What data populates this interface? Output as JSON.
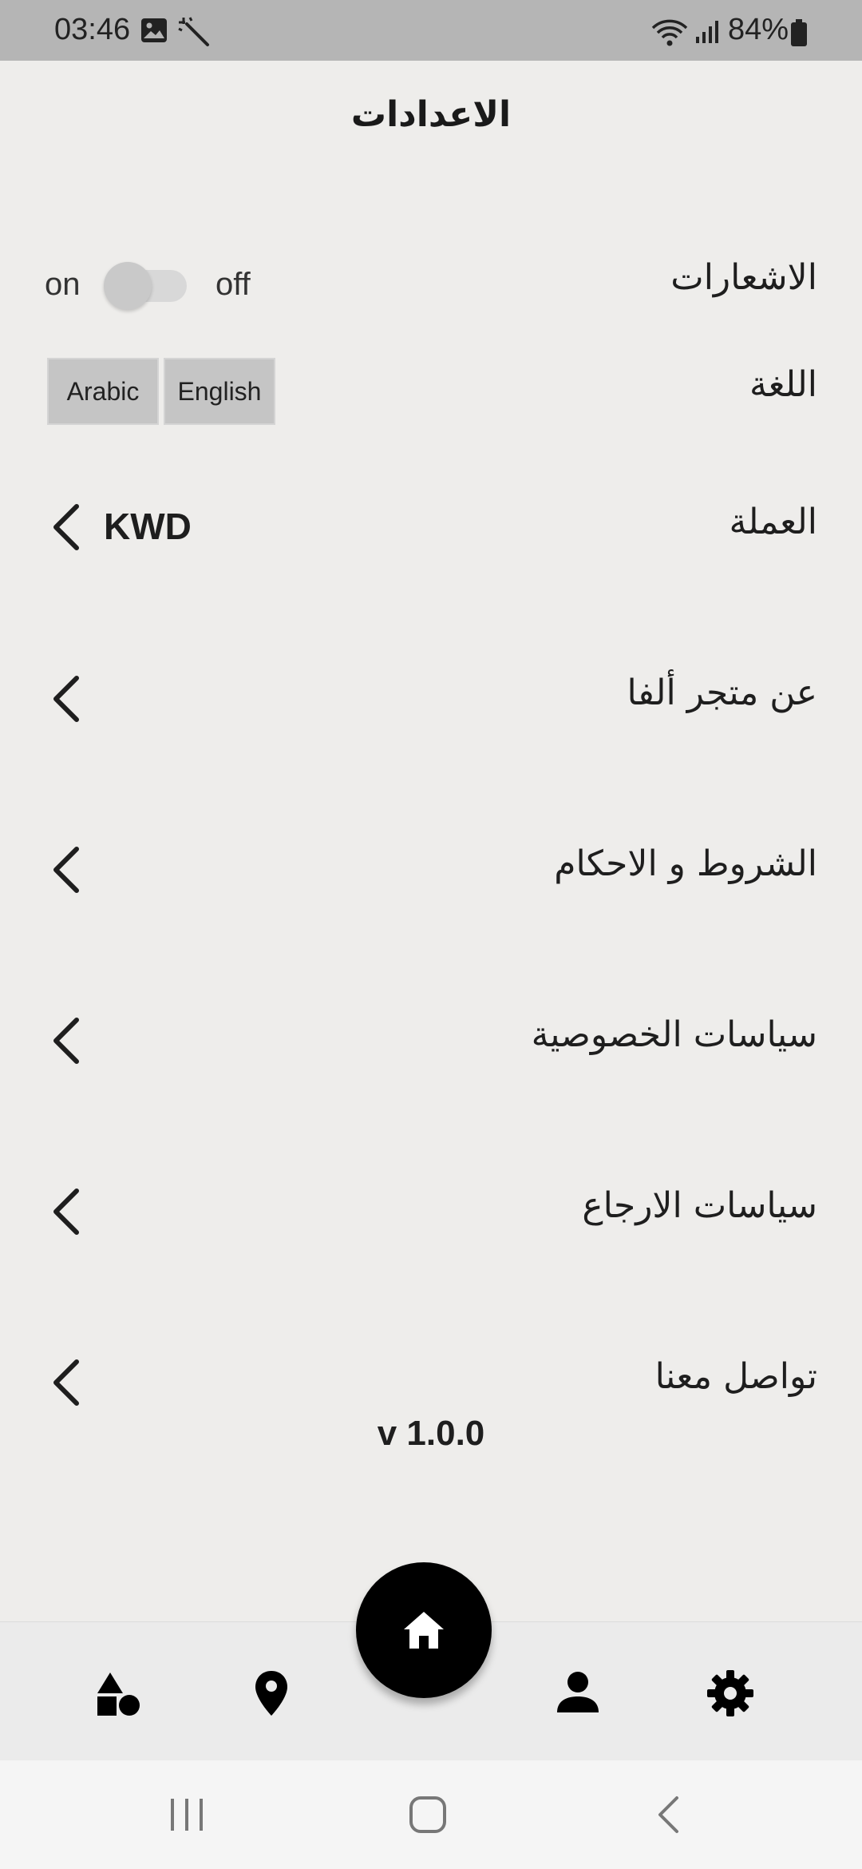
{
  "status_bar": {
    "time": "03:46",
    "battery": "84%"
  },
  "header": {
    "title": "الاعدادات"
  },
  "notifications": {
    "label": "الاشعارات",
    "on_label": "on",
    "off_label": "off"
  },
  "language": {
    "label": "اللغة",
    "options": [
      "Arabic",
      "English"
    ]
  },
  "currency": {
    "label": "العملة",
    "value": "KWD"
  },
  "menu": {
    "about": "عن متجر ألفا",
    "terms": "الشروط و الاحكام",
    "privacy": "سياسات الخصوصية",
    "returns": "سياسات الارجاع",
    "contact": "تواصل معنا"
  },
  "version": "v 1.0.0",
  "bottom_nav": {
    "icons": [
      "shapes-icon",
      "location-pin-icon",
      "home-icon",
      "person-icon",
      "gear-icon"
    ]
  }
}
